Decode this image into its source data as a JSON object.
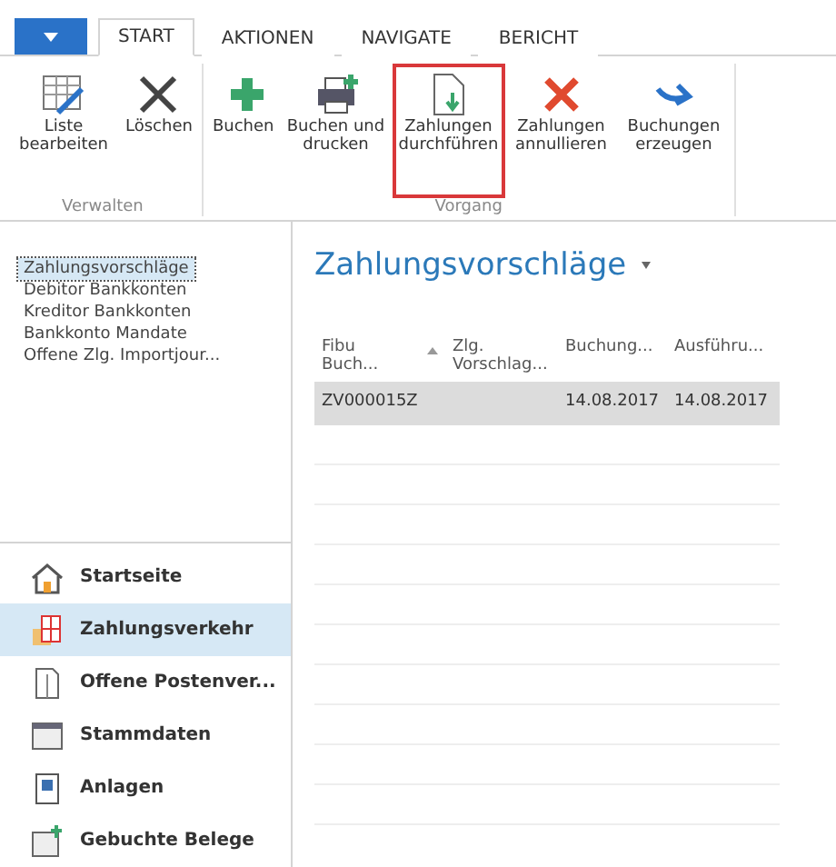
{
  "ribbon_tabs": [
    {
      "label": "START",
      "selected": true
    },
    {
      "label": "AKTIONEN",
      "selected": false
    },
    {
      "label": "NAVIGATE",
      "selected": false
    },
    {
      "label": "BERICHT",
      "selected": false
    }
  ],
  "ribbon_groups": [
    {
      "label": "Verwalten",
      "buttons": [
        {
          "kind": "edit-list",
          "label": "Liste bearbeiten",
          "highlighted": false
        },
        {
          "kind": "delete",
          "label": "Löschen",
          "highlighted": false
        }
      ]
    },
    {
      "label": "Vorgang",
      "buttons": [
        {
          "kind": "post",
          "label": "Buchen",
          "highlighted": false
        },
        {
          "kind": "print",
          "label": "Buchen und drucken",
          "highlighted": false
        },
        {
          "kind": "document",
          "label": "Zahlungen durchführen",
          "highlighted": true
        },
        {
          "kind": "cancel",
          "label": "Zahlungen annullieren",
          "highlighted": false
        },
        {
          "kind": "arrow",
          "label": "Buchungen erzeugen",
          "highlighted": false
        }
      ]
    }
  ],
  "nav_links": [
    {
      "label": "Zahlungsvorschläge",
      "selected": true
    },
    {
      "label": "Debitor Bankkonten",
      "selected": false
    },
    {
      "label": "Kreditor Bankkonten",
      "selected": false
    },
    {
      "label": "Bankkonto Mandate",
      "selected": false
    },
    {
      "label": "Offene Zlg. Importjour...",
      "selected": false
    }
  ],
  "nav_areas": [
    {
      "kind": "home",
      "label": "Startseite",
      "selected": false
    },
    {
      "kind": "payments",
      "label": "Zahlungsverkehr",
      "selected": true
    },
    {
      "kind": "document",
      "label": "Offene Postenver...",
      "selected": false
    },
    {
      "kind": "window",
      "label": "Stammdaten",
      "selected": false
    },
    {
      "kind": "book",
      "label": "Anlagen",
      "selected": false
    },
    {
      "kind": "post",
      "label": "Gebuchte Belege",
      "selected": false
    }
  ],
  "page_title": "Zahlungsvorschläge",
  "table": {
    "columns": [
      {
        "label": "Fibu Buch...",
        "sorted": true
      },
      {
        "label": "Zlg. Vorschlag...",
        "sorted": false
      },
      {
        "label": "Buchung...",
        "sorted": false
      },
      {
        "label": "Ausführu...",
        "sorted": false
      }
    ],
    "rows": [
      {
        "cells": [
          "ZV000015Z",
          "",
          "14.08.2017",
          "14.08.2017"
        ],
        "selected": true
      }
    ]
  }
}
